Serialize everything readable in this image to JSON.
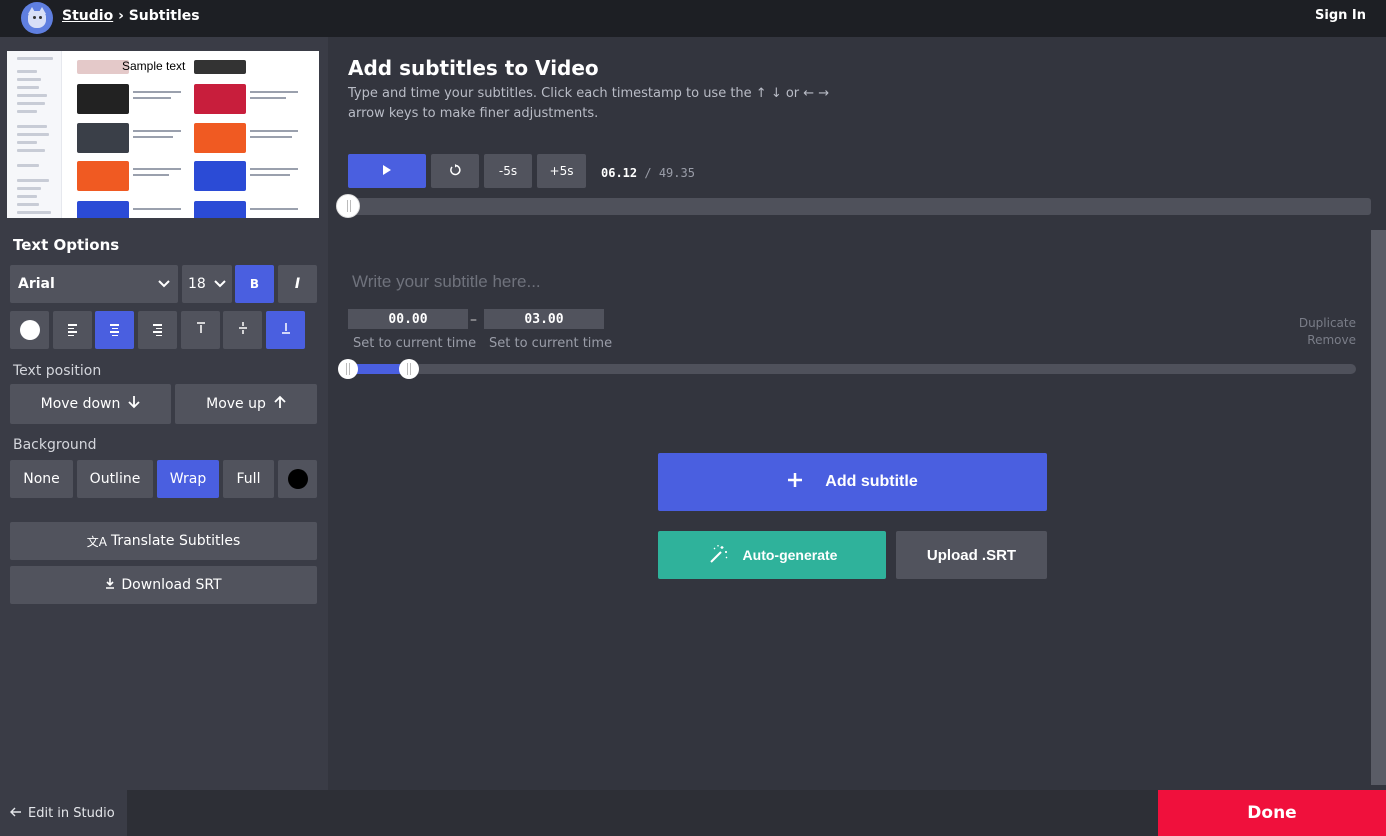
{
  "header": {
    "breadcrumb_studio": "Studio",
    "breadcrumb_sep": "›",
    "breadcrumb_current": "Subtitles",
    "sign_in": "Sign In"
  },
  "preview": {
    "sample_text": "Sample text"
  },
  "text_options": {
    "heading": "Text Options",
    "font": "Arial",
    "font_size": "18",
    "bold_label": "B",
    "italic_label": "I"
  },
  "text_position": {
    "label": "Text position",
    "move_down": "Move down",
    "move_up": "Move up"
  },
  "background": {
    "label": "Background",
    "options": [
      "None",
      "Outline",
      "Wrap",
      "Full"
    ],
    "selected": "Wrap",
    "color": "#000000"
  },
  "actions": {
    "translate": "Translate Subtitles",
    "download": "Download SRT"
  },
  "footer": {
    "edit_in_studio": "Edit in Studio",
    "done": "Done"
  },
  "main": {
    "title": "Add subtitles to Video",
    "description": "Type and time your subtitles. Click each timestamp to use the ↑ ↓ or ← → arrow keys to make finer adjustments.",
    "skip_back": "-5s",
    "skip_forward": "+5s",
    "current_time": "06.12",
    "time_sep": "/",
    "total_time": "49.35"
  },
  "subtitle_entry": {
    "placeholder": "Write your subtitle here...",
    "start": "00.00",
    "end": "03.00",
    "range_sep": "–",
    "set_current_start": "Set to current time",
    "set_current_end": "Set to current time",
    "duplicate": "Duplicate",
    "remove": "Remove"
  },
  "buttons": {
    "add_subtitle": "Add subtitle",
    "auto_generate": "Auto-generate",
    "upload_srt": "Upload .SRT"
  },
  "colors": {
    "accent": "#4a5fe0",
    "auto_generate": "#2fb29b",
    "done": "#f0103c",
    "text_color": "#ffffff"
  }
}
